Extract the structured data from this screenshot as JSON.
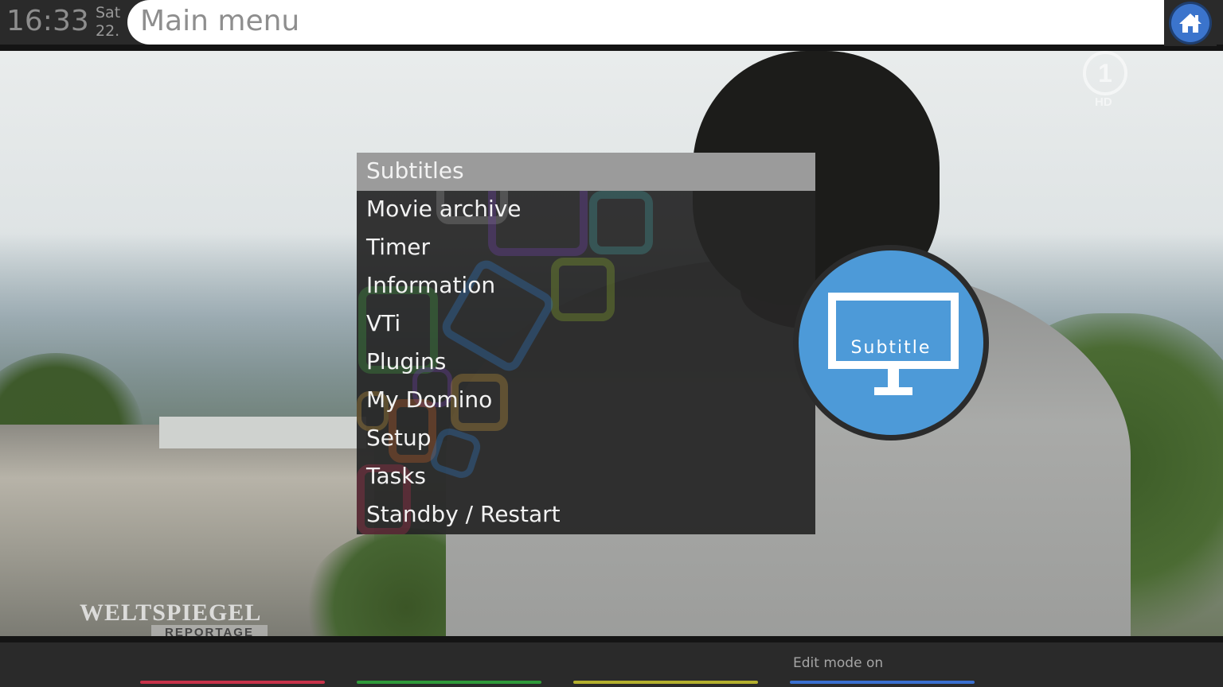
{
  "top_bar": {
    "time": "16:33",
    "day": "Sat",
    "date": "22.",
    "title": "Main menu"
  },
  "menu": {
    "selected_index": 0,
    "items": [
      "Subtitles",
      "Movie archive",
      "Timer",
      "Information",
      "VTi",
      "Plugins",
      "My Domino",
      "Setup",
      "Tasks",
      "Standby / Restart"
    ]
  },
  "preview_icon": {
    "label": "Subtitle",
    "icon": "monitor-icon",
    "color": "#4d9ad8"
  },
  "overlay": {
    "channel_logo": "1",
    "channel_hd": "HD",
    "show_title": "WELTSPIEGEL",
    "show_subtitle": "REPORTAGE"
  },
  "bottom_bar": {
    "keys": [
      {
        "color": "#c8334a",
        "label": ""
      },
      {
        "color": "#2f9a3a",
        "label": ""
      },
      {
        "color": "#b4b02e",
        "label": ""
      },
      {
        "color": "#3a6fd0",
        "label": "Edit mode on"
      }
    ]
  },
  "colors": {
    "bar_background": "#2a2a2a",
    "menu_selected": "#9b9b9b",
    "home_button": "#3b74cc"
  }
}
